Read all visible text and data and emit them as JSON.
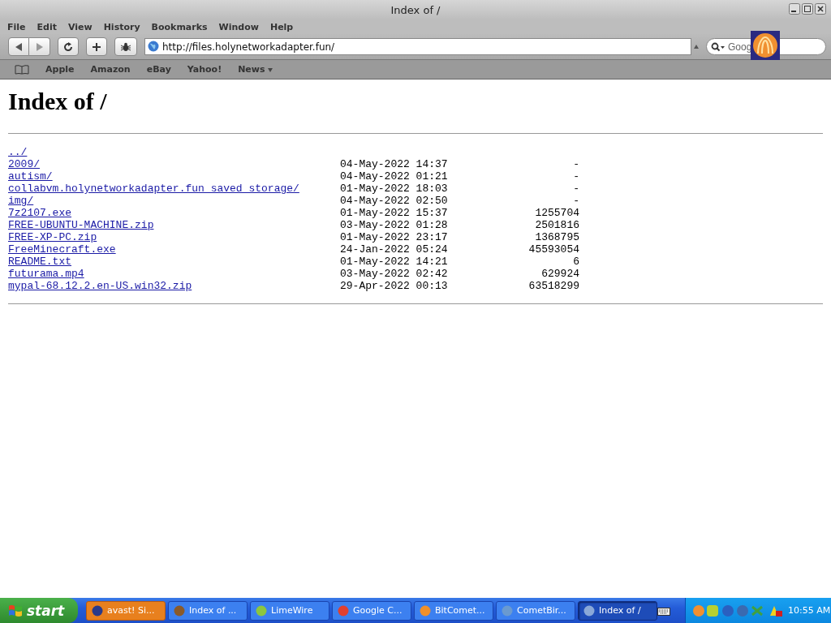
{
  "window": {
    "title": "Index of /"
  },
  "menu": [
    "File",
    "Edit",
    "View",
    "History",
    "Bookmarks",
    "Window",
    "Help"
  ],
  "address": {
    "value": "http://files.holynetworkadapter.fun/"
  },
  "search": {
    "placeholder": "Goog"
  },
  "bookmarks": [
    {
      "label": "Apple",
      "kind": "link"
    },
    {
      "label": "Amazon",
      "kind": "link"
    },
    {
      "label": "eBay",
      "kind": "link"
    },
    {
      "label": "Yahoo!",
      "kind": "link"
    },
    {
      "label": "News",
      "kind": "folder"
    }
  ],
  "page": {
    "heading": "Index of /",
    "entries": [
      {
        "name": "../"
      },
      {
        "name": "2009/",
        "date": "04-May-2022 14:37",
        "size": "-"
      },
      {
        "name": "autism/",
        "date": "04-May-2022 01:21",
        "size": "-"
      },
      {
        "name": "collabvm.holynetworkadapter.fun saved storage/",
        "date": "01-May-2022 18:03",
        "size": "-"
      },
      {
        "name": "img/",
        "date": "04-May-2022 02:50",
        "size": "-"
      },
      {
        "name": "7z2107.exe",
        "date": "01-May-2022 15:37",
        "size": "1255704"
      },
      {
        "name": "FREE-UBUNTU-MACHINE.zip",
        "date": "03-May-2022 01:28",
        "size": "2501816"
      },
      {
        "name": "FREE-XP-PC.zip",
        "date": "01-May-2022 23:17",
        "size": "1368795"
      },
      {
        "name": "FreeMinecraft.exe",
        "date": "24-Jan-2022 05:24",
        "size": "45593054"
      },
      {
        "name": "README.txt",
        "date": "01-May-2022 14:21",
        "size": "6"
      },
      {
        "name": "futurama.mp4",
        "date": "03-May-2022 02:42",
        "size": "629924"
      },
      {
        "name": "mypal-68.12.2.en-US.win32.zip",
        "date": "29-Apr-2022 00:13",
        "size": "63518299"
      }
    ]
  },
  "taskbar": {
    "start": "start",
    "tasks": [
      {
        "label": "avast! Si...",
        "selected": false,
        "flashing": true,
        "color": "#2a3a8a"
      },
      {
        "label": "Index of ...",
        "selected": false,
        "flashing": false,
        "color": "#8a5a2a"
      },
      {
        "label": "LimeWire",
        "selected": false,
        "flashing": false,
        "color": "#8cc63f"
      },
      {
        "label": "Google C...",
        "selected": false,
        "flashing": false,
        "color": "#e04030"
      },
      {
        "label": "BitComet...",
        "selected": false,
        "flashing": false,
        "color": "#f0902a"
      },
      {
        "label": "CometBir...",
        "selected": false,
        "flashing": false,
        "color": "#6a9ad0"
      },
      {
        "label": "Index of /",
        "selected": true,
        "flashing": false,
        "color": "#8aa8d8"
      }
    ],
    "clock": "10:55 AM"
  }
}
